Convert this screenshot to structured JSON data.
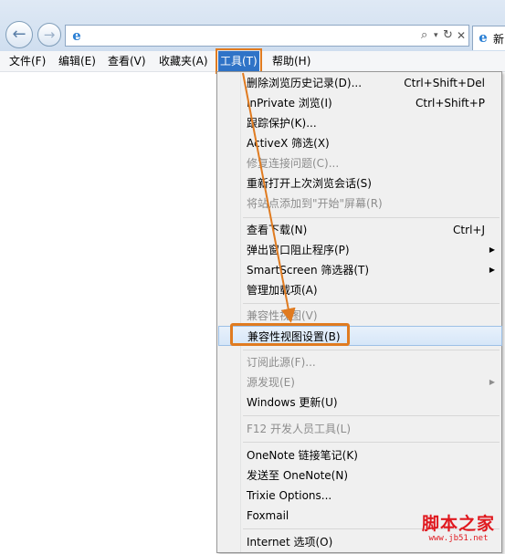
{
  "tab": {
    "label": "新"
  },
  "menubar": {
    "items": [
      "文件(F)",
      "编辑(E)",
      "查看(V)",
      "收藏夹(A)",
      "工具(T)",
      "帮助(H)"
    ]
  },
  "tools_menu": {
    "items": [
      {
        "label": "删除浏览历史记录(D)...",
        "shortcut": "Ctrl+Shift+Del"
      },
      {
        "label": "InPrivate 浏览(I)",
        "shortcut": "Ctrl+Shift+P"
      },
      {
        "label": "跟踪保护(K)...",
        "shortcut": ""
      },
      {
        "label": "ActiveX 筛选(X)",
        "shortcut": ""
      },
      {
        "label": "修复连接问题(C)...",
        "shortcut": ""
      },
      {
        "label": "重新打开上次浏览会话(S)",
        "shortcut": ""
      },
      {
        "label": "将站点添加到\"开始\"屏幕(R)",
        "shortcut": ""
      },
      {
        "label": "查看下载(N)",
        "shortcut": "Ctrl+J"
      },
      {
        "label": "弹出窗口阻止程序(P)",
        "shortcut": ""
      },
      {
        "label": "SmartScreen 筛选器(T)",
        "shortcut": ""
      },
      {
        "label": "管理加载项(A)",
        "shortcut": ""
      },
      {
        "label": "兼容性视图(V)",
        "shortcut": ""
      },
      {
        "label": "兼容性视图设置(B)",
        "shortcut": ""
      },
      {
        "label": "订阅此源(F)...",
        "shortcut": ""
      },
      {
        "label": "源发现(E)",
        "shortcut": ""
      },
      {
        "label": "Windows 更新(U)",
        "shortcut": ""
      },
      {
        "label": "F12 开发人员工具(L)",
        "shortcut": ""
      },
      {
        "label": "OneNote 链接笔记(K)",
        "shortcut": ""
      },
      {
        "label": "发送至 OneNote(N)",
        "shortcut": ""
      },
      {
        "label": "Trixie Options...",
        "shortcut": ""
      },
      {
        "label": "Foxmail",
        "shortcut": ""
      },
      {
        "label": "Internet 选项(O)",
        "shortcut": ""
      }
    ]
  },
  "watermark": {
    "line1": "脚本之家",
    "line2": "www.jb51.net"
  },
  "colors": {
    "highlight_outline": "#e07b20",
    "menu_active": "#2f73c7",
    "disabled_text": "#8d8d8d"
  }
}
